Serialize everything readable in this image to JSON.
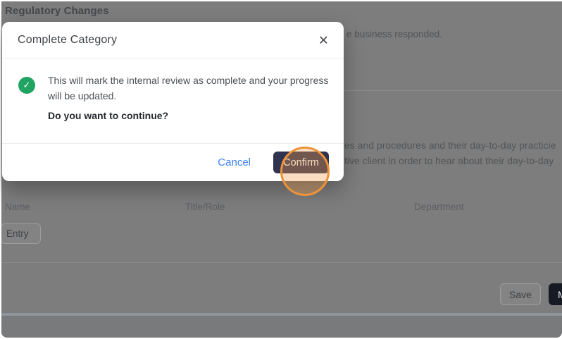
{
  "page": {
    "title": "Regulatory Changes",
    "intro_fragment": "e business responded.",
    "section": {
      "desc_line1_fragment": "es and procedures and their day-to-day practicie",
      "desc_line2_fragment": "tive client in order to hear about their day-to-day"
    },
    "table": {
      "headers": [
        "Name",
        "Title/Role",
        "Department"
      ],
      "add_entry_label": "Entry"
    },
    "footer": {
      "save_label": "Save",
      "dark_button_partial_label": "M"
    }
  },
  "modal": {
    "title": "Complete Category",
    "close_glyph": "×",
    "message": "This will mark the internal review as complete and your progress will be updated.",
    "question": "Do you want to continue?",
    "cancel_label": "Cancel",
    "confirm_label": "Confirm",
    "check_glyph": "✓"
  },
  "colors": {
    "accent_blue": "#3b82f6",
    "confirm_navy": "#2f3350",
    "success_green": "#21a462",
    "annotation_orange": "#ed9337",
    "dark_button": "#161a23",
    "backdrop_gray": "#7d7d7d"
  }
}
